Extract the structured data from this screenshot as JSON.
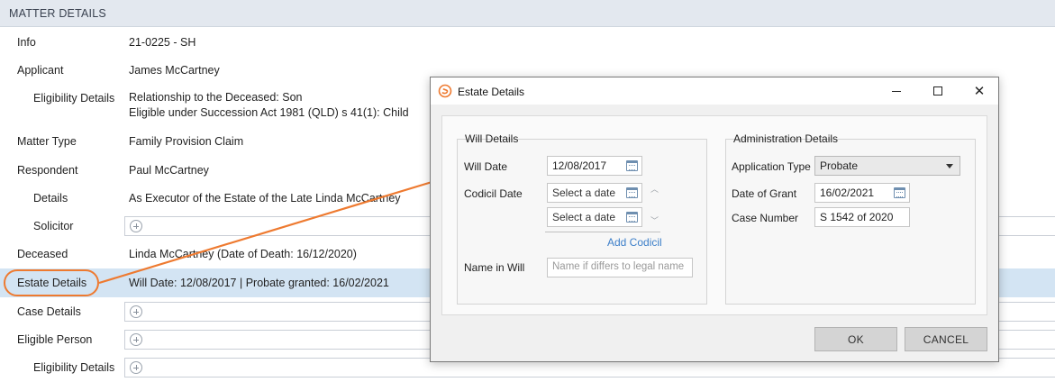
{
  "section": {
    "title": "MATTER DETAILS"
  },
  "rows": [
    {
      "label": "Info",
      "value": "21-0225 - SH"
    },
    {
      "label": "Applicant",
      "value": "James McCartney"
    },
    {
      "label": "Eligibility Details",
      "value_lines": [
        "Relationship to the Deceased: Son",
        "Eligible under Succession Act 1981 (QLD) s 41(1): Child"
      ]
    },
    {
      "label": "Matter Type",
      "value": "Family Provision Claim"
    },
    {
      "label": "Respondent",
      "value": "Paul McCartney"
    },
    {
      "label": "Details",
      "value": "As Executor of the Estate of the Late Linda McCartney"
    },
    {
      "label": "Solicitor",
      "value": ""
    },
    {
      "label": "Deceased",
      "value": "Linda McCartney (Date of Death: 16/12/2020)"
    },
    {
      "label": "Estate Details",
      "value": "Will Date: 12/08/2017 | Probate granted: 16/02/2021"
    },
    {
      "label": "Case Details",
      "value": ""
    },
    {
      "label": "Eligible Person",
      "value": ""
    },
    {
      "label": "Eligibility Details",
      "value": ""
    }
  ],
  "dialog": {
    "title": "Estate Details",
    "will_details": {
      "title": "Will Details",
      "will_date_label": "Will Date",
      "will_date_value": "12/08/2017",
      "codicil_date_label": "Codicil Date",
      "codicil_placeholder_1": "Select a date",
      "codicil_placeholder_2": "Select a date",
      "add_codicil": "Add Codicil",
      "name_in_will_label": "Name in Will",
      "name_in_will_placeholder": "Name if differs to legal name"
    },
    "admin_details": {
      "title": "Administration Details",
      "application_type_label": "Application Type",
      "application_type_value": "Probate",
      "date_of_grant_label": "Date of Grant",
      "date_of_grant_value": "16/02/2021",
      "case_number_label": "Case Number",
      "case_number_value": "S 1542 of 2020"
    },
    "buttons": {
      "ok": "OK",
      "cancel": "CANCEL"
    }
  },
  "colors": {
    "accent": "#ee7a30",
    "highlight_row": "#d3e4f3",
    "link": "#3d7fc9",
    "header_bg": "#e3e8ef"
  },
  "icons": [
    "app-logo-icon",
    "minimize-icon",
    "maximize-icon",
    "close-icon",
    "calendar-icon",
    "add-circle-icon",
    "dropdown-caret-icon",
    "scroll-up-icon",
    "scroll-down-icon"
  ]
}
